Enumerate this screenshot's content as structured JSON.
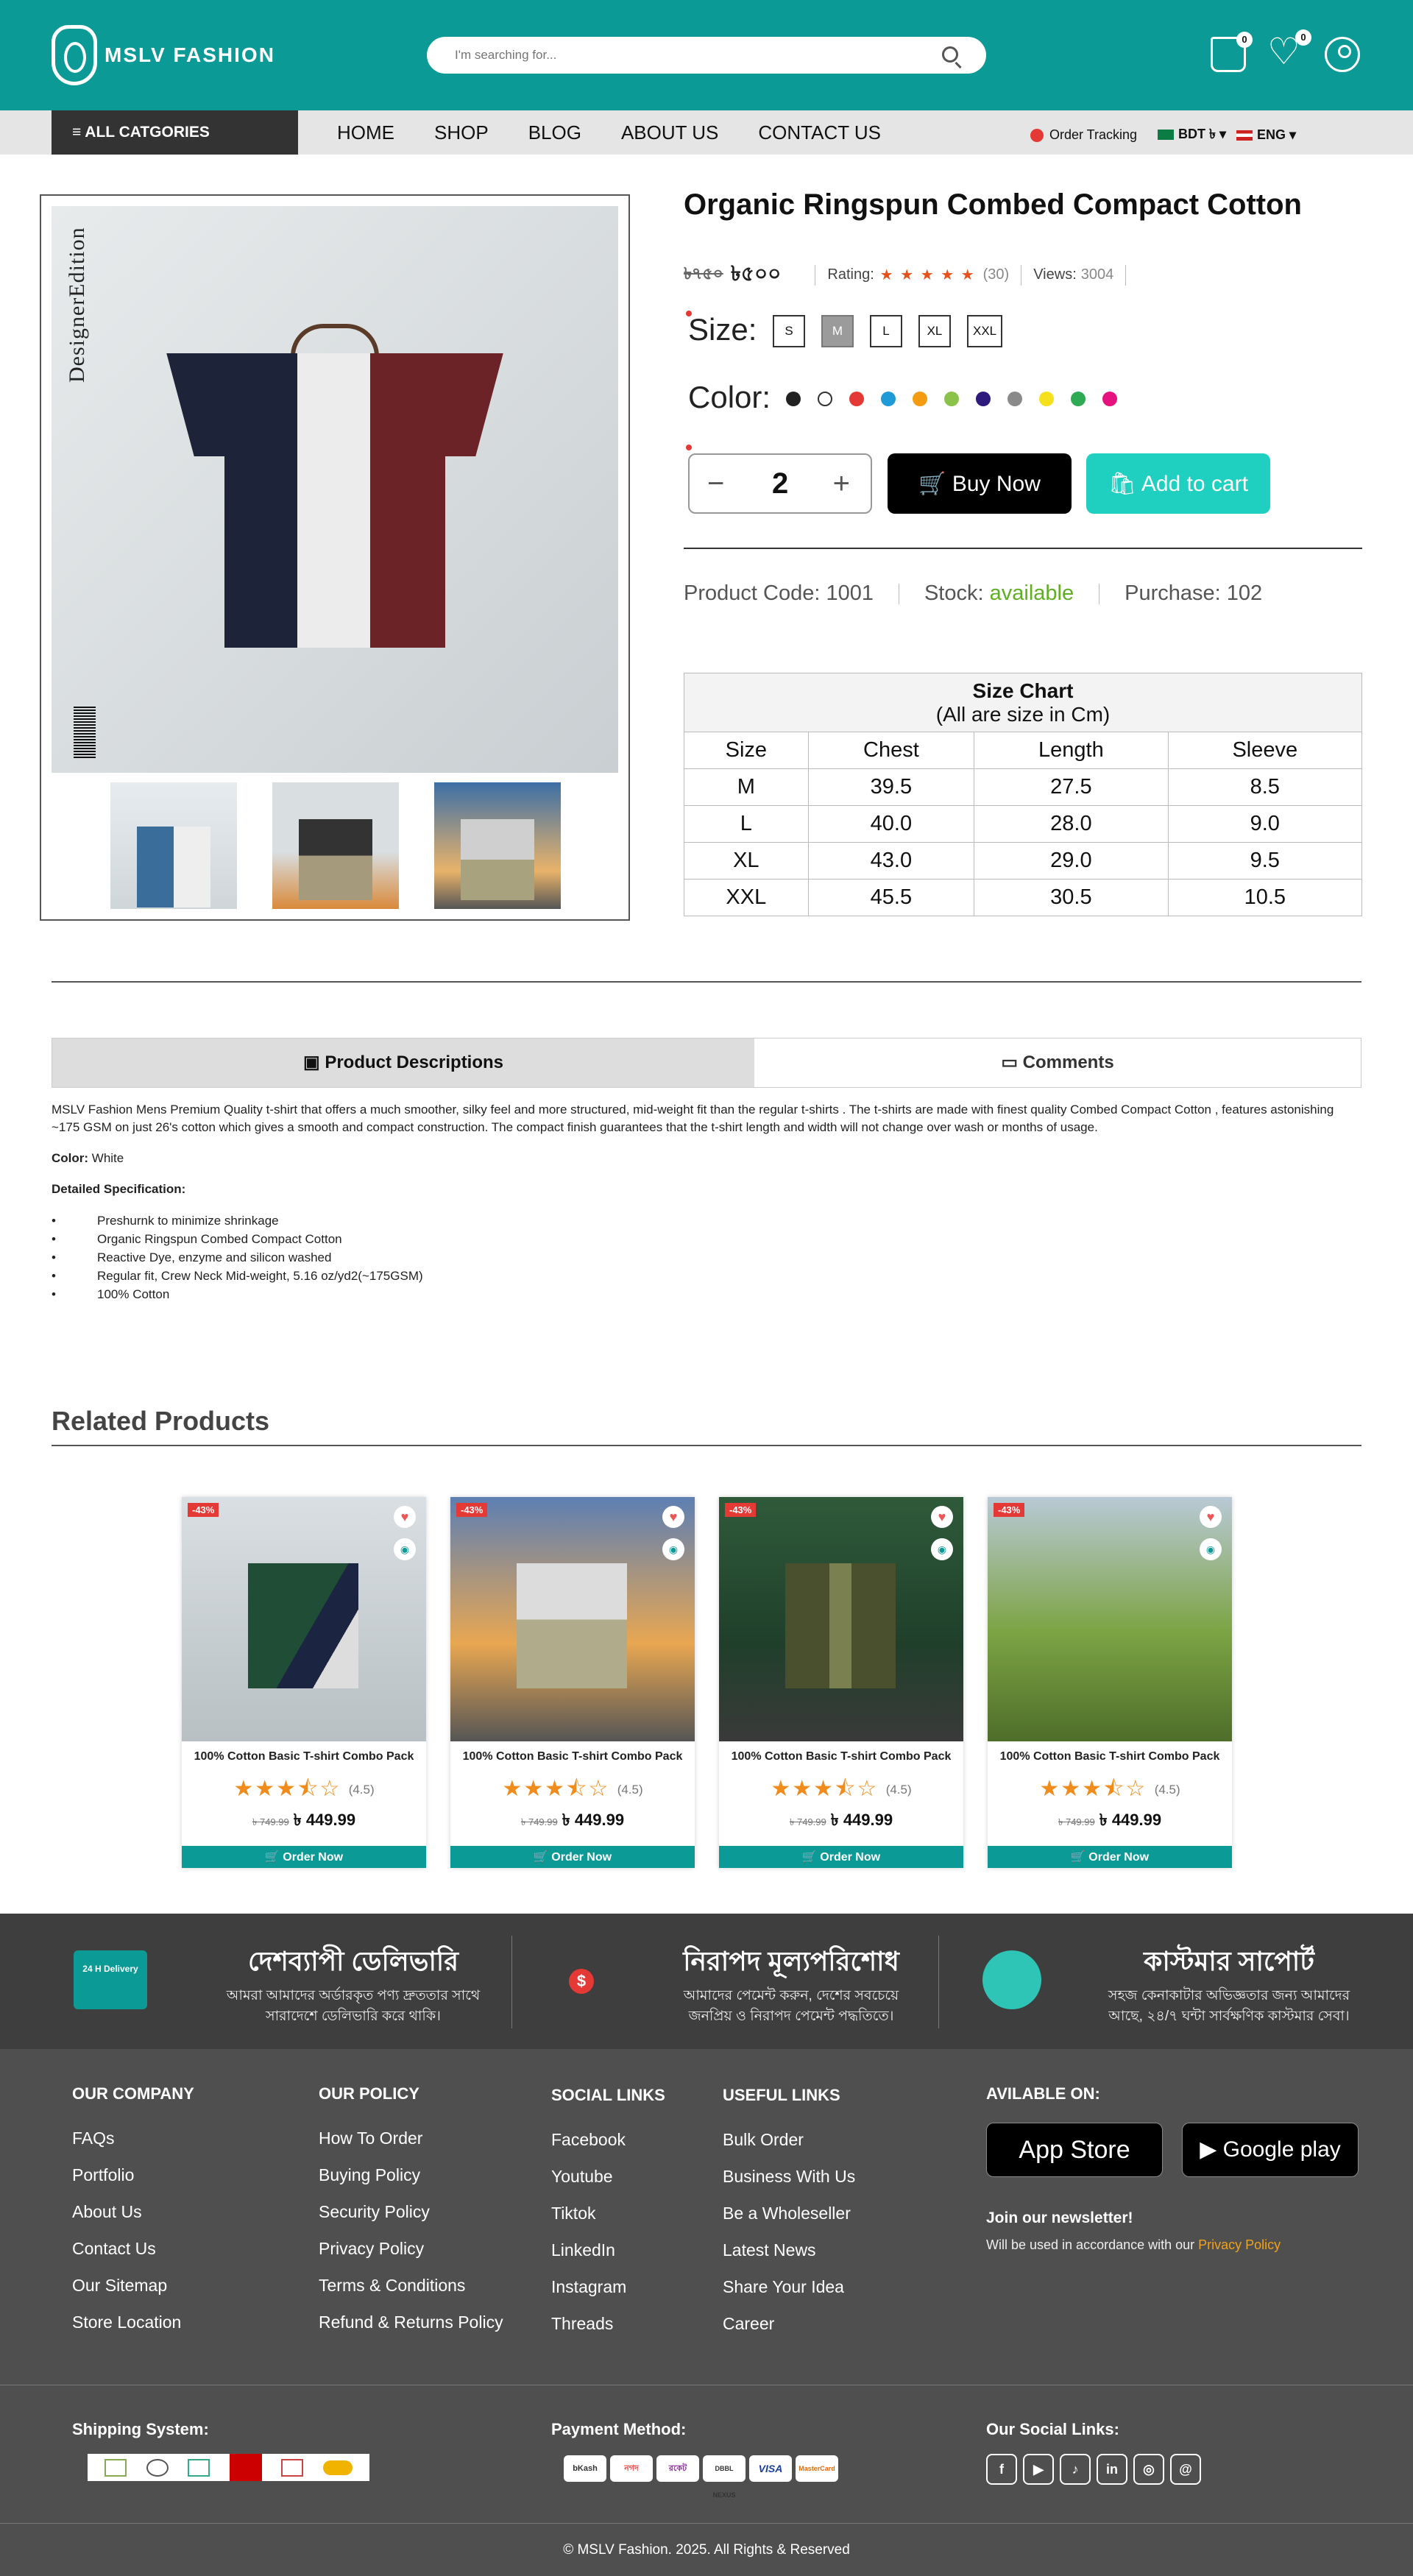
{
  "brand": "MSLV FASHION",
  "search": {
    "placeholder": "I'm searching for..."
  },
  "header_counts": {
    "cart": "0",
    "wishlist": "0"
  },
  "nav": {
    "categories": "≡ ALL CATGORIES",
    "links": [
      "HOME",
      "SHOP",
      "BLOG",
      "ABOUT US",
      "CONTACT US"
    ],
    "tracking": "Order Tracking",
    "currency": "BDT ৳ ▾",
    "language": "ENG ▾"
  },
  "product": {
    "title": "Organic Ringspun Combed Compact Cotton",
    "old_price": "৳৭৫০",
    "price": "৳৫০০",
    "rating_label": "Rating:",
    "rating_stars": "★ ★ ★ ★ ★",
    "rating_count": "(30)",
    "views_label": "Views:",
    "views": "3004",
    "size_label": "Size:",
    "sizes": [
      "S",
      "M",
      "L",
      "XL",
      "XXL"
    ],
    "selected_size": "M",
    "color_label": "Color:",
    "colors": [
      "#222222",
      "#ffffff",
      "#e53935",
      "#1e9bd7",
      "#f39c12",
      "#8bc34a",
      "#2e1a7d",
      "#8a8a8a",
      "#f5e11b",
      "#2eaa55",
      "#e6127d"
    ],
    "quantity": "2",
    "qty_minus": "−",
    "qty_plus": "+",
    "buy_now": "Buy Now",
    "add_to_cart": "Add to cart",
    "image_side_text": "DesignerEdition"
  },
  "meta": {
    "code_label": "Product Code:",
    "code": "1001",
    "stock_label": "Stock:",
    "stock": "available",
    "purchase_label": "Purchase:",
    "purchase": "102"
  },
  "size_chart": {
    "title": "Size Chart",
    "subtitle": "(All are size in Cm)",
    "headers": [
      "Size",
      "Chest",
      "Length",
      "Sleeve"
    ],
    "rows": [
      [
        "M",
        "39.5",
        "27.5",
        "8.5"
      ],
      [
        "L",
        "40.0",
        "28.0",
        "9.0"
      ],
      [
        "XL",
        "43.0",
        "29.0",
        "9.5"
      ],
      [
        "XXL",
        "45.5",
        "30.5",
        "10.5"
      ]
    ]
  },
  "tabs": {
    "descriptions": "Product Descriptions",
    "comments": "Comments"
  },
  "description": {
    "paragraph": "MSLV Fashion Mens Premium Quality t-shirt that offers a much smoother, silky feel and more structured, mid-weight fit than the regular t-shirts . The t-shirts are made with finest quality Combed Compact Cotton , features astonishing ~175 GSM on just 26's cotton which gives a smooth and compact construction. The compact finish guarantees that the t-shirt length and width will not change over wash or months of usage.",
    "color_label": "Color:",
    "color_value": "White",
    "spec_title": "Detailed Specification:",
    "specs": [
      "Preshurnk to minimize shrinkage",
      "Organic Ringspun Combed Compact Cotton",
      "Reactive Dye, enzyme and silicon washed",
      "Regular fit, Crew Neck Mid-weight, 5.16 oz/yd2(~175GSM)",
      "100% Cotton"
    ]
  },
  "related": {
    "title": "Related Products",
    "items": [
      {
        "discount": "-43%",
        "name": "100% Cotton Basic T-shirt Combo Pack",
        "stars": "★★★⯪☆",
        "rating": "(4.5)",
        "old_price": "৳ 749.99",
        "price": "৳ 449.99",
        "cta": "Order Now"
      },
      {
        "discount": "-43%",
        "name": "100% Cotton Basic T-shirt Combo Pack",
        "stars": "★★★⯪☆",
        "rating": "(4.5)",
        "old_price": "৳ 749.99",
        "price": "৳ 449.99",
        "cta": "Order Now"
      },
      {
        "discount": "-43%",
        "name": "100% Cotton Basic T-shirt Combo Pack",
        "stars": "★★★⯪☆",
        "rating": "(4.5)",
        "old_price": "৳ 749.99",
        "price": "৳ 449.99",
        "cta": "Order Now"
      },
      {
        "discount": "-43%",
        "name": "100% Cotton Basic T-shirt Combo Pack",
        "stars": "★★★⯪☆",
        "rating": "(4.5)",
        "old_price": "৳ 749.99",
        "price": "৳ 449.99",
        "cta": "Order Now"
      }
    ]
  },
  "features": [
    {
      "title": "দেশব্যাপী ডেলিভারি",
      "line1": "আমরা আমাদের অর্ডারকৃত পণ্য দ্রুততার সাথে",
      "line2": "সারাদেশে ডেলিভারি করে থাকি।",
      "icon_text": "24 H Delivery"
    },
    {
      "title": "নিরাপদ মূল্যপরিশোধ",
      "line1": "আমাদের পেমেন্ট করুন, দেশের সবচেয়ে",
      "line2": "জনপ্রিয় ও নিরাপদ পেমেন্ট পদ্ধতিতে।",
      "icon_text": "$"
    },
    {
      "title": "কাস্টমার সাপোর্ট",
      "line1": "সহজ কেনাকাটার অভিজ্ঞতার জন্য আমাদের",
      "line2": "আছে, ২৪/৭ ঘন্টা সার্বক্ষণিক কাস্টমার সেবা।",
      "icon_text": ""
    }
  ],
  "footer": {
    "company": {
      "title": "OUR COMPANY",
      "links": [
        "FAQs",
        "Portfolio",
        "About Us",
        "Contact Us",
        "Our Sitemap",
        "Store Location"
      ]
    },
    "policy": {
      "title": "OUR POLICY",
      "links": [
        "How To Order",
        "Buying Policy",
        "Security Policy",
        "Privacy Policy",
        "Terms & Conditions",
        "Refund & Returns Policy"
      ]
    },
    "social": {
      "title": "SOCIAL LINKS",
      "links": [
        "Facebook",
        "Youtube",
        "Tiktok",
        "LinkedIn",
        "Instagram",
        "Threads"
      ]
    },
    "useful": {
      "title": "USEFUL LINKS",
      "links": [
        "Bulk Order",
        "Business With Us",
        "Be a Wholeseller",
        "Latest News",
        "Share Your Idea",
        "Career"
      ]
    },
    "available_title": "AVILABLE ON:",
    "app_store": " App Store",
    "google_play": "▶ Google play",
    "newsletter_title": "Join our newsletter!",
    "newsletter_text": "Will be used in accordance with our",
    "privacy_link": "Privacy Policy",
    "shipping_title": "Shipping System:",
    "payment_title": "Payment Method:",
    "payment_methods": [
      "bKash",
      "নগদ",
      "রকেট",
      "DBBL NEXUS",
      "VISA",
      "MasterCard"
    ],
    "social_title": "Our Social Links:",
    "social_icons": [
      "f",
      "▶",
      "♪",
      "in",
      "◎",
      "@"
    ],
    "copyright": "© MSLV Fashion. 2025. All Rights & Reserved"
  }
}
